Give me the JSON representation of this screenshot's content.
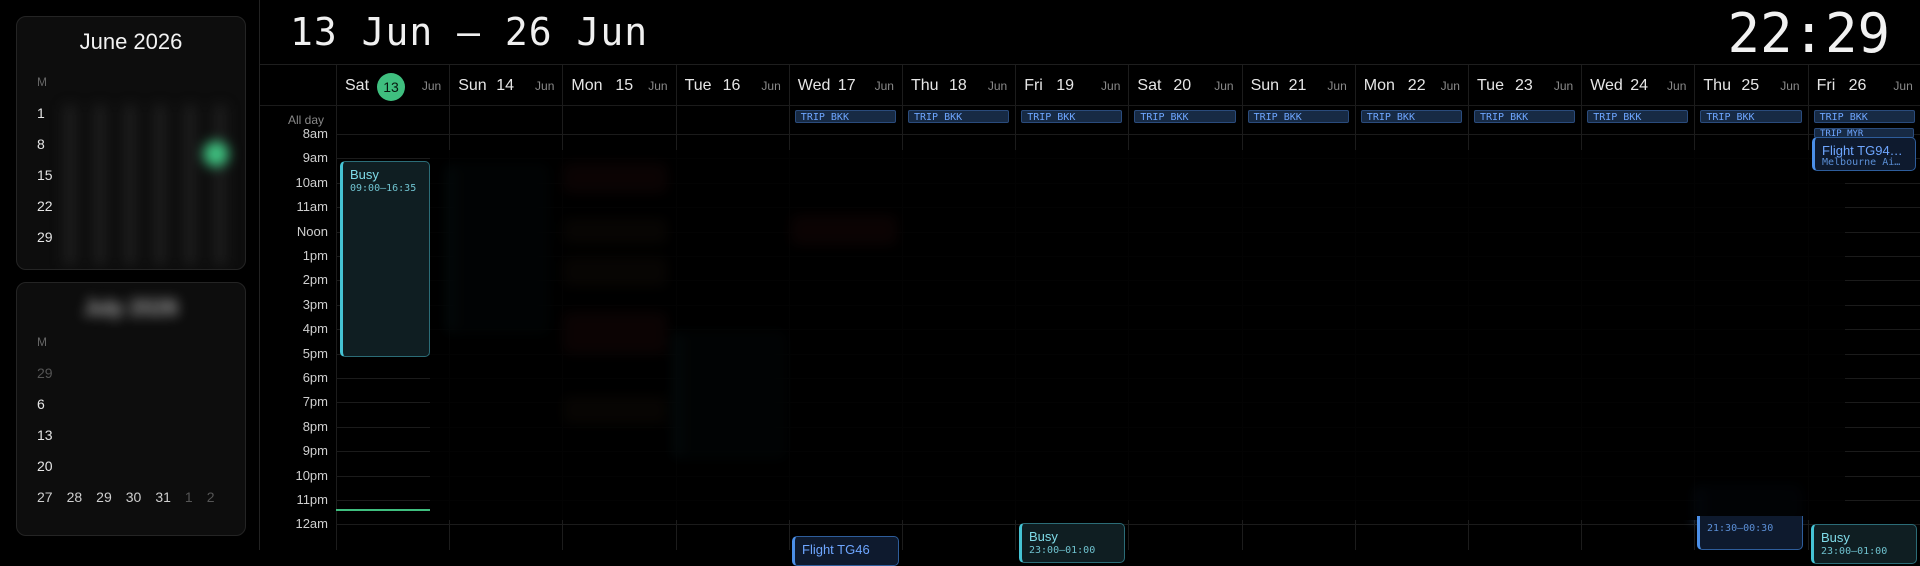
{
  "header": {
    "range": "13 Jun – 26 Jun",
    "clock": "22:29"
  },
  "sidebar": {
    "june": {
      "title": "June 2026",
      "weekday_initial": "M",
      "rows": [
        "1",
        "8",
        "15",
        "22",
        "29"
      ],
      "today": "13"
    },
    "july": {
      "title": "July 2026",
      "weekday_initial": "M",
      "rows": [
        "29",
        "6",
        "13",
        "20",
        "27"
      ],
      "last_row": [
        "27",
        "28",
        "29",
        "30",
        "31",
        "1",
        "2"
      ]
    }
  },
  "grid": {
    "allday_label": "All day",
    "time_labels": [
      "8am",
      "9am",
      "10am",
      "11am",
      "Noon",
      "1pm",
      "2pm",
      "3pm",
      "4pm",
      "5pm",
      "6pm",
      "7pm",
      "8pm",
      "9pm",
      "10pm",
      "11pm",
      "12am"
    ],
    "days": [
      {
        "name": "Sat",
        "date": "13",
        "month": "Jun",
        "today": true
      },
      {
        "name": "Sun",
        "date": "14",
        "month": "Jun"
      },
      {
        "name": "Mon",
        "date": "15",
        "month": "Jun"
      },
      {
        "name": "Tue",
        "date": "16",
        "month": "Jun"
      },
      {
        "name": "Wed",
        "date": "17",
        "month": "Jun"
      },
      {
        "name": "Thu",
        "date": "18",
        "month": "Jun"
      },
      {
        "name": "Fri",
        "date": "19",
        "month": "Jun"
      },
      {
        "name": "Sat",
        "date": "20",
        "month": "Jun"
      },
      {
        "name": "Sun",
        "date": "21",
        "month": "Jun"
      },
      {
        "name": "Mon",
        "date": "22",
        "month": "Jun"
      },
      {
        "name": "Tue",
        "date": "23",
        "month": "Jun"
      },
      {
        "name": "Wed",
        "date": "24",
        "month": "Jun"
      },
      {
        "name": "Thu",
        "date": "25",
        "month": "Jun"
      },
      {
        "name": "Fri",
        "date": "26",
        "month": "Jun"
      }
    ],
    "trip_label": "TRIP BKK",
    "trip_myr_label": "TRIP MYR"
  },
  "events": {
    "sat_busy": {
      "title": "Busy",
      "time": "09:00–16:35"
    },
    "fri26_flight": {
      "title": "Flight TG94…",
      "sub": "Melbourne Ai…"
    },
    "wed_flight": {
      "title": "Flight TG46"
    },
    "fri19_busy": {
      "title": "Busy",
      "time": "23:00–01:00"
    },
    "thu25_event": {
      "time": "21:30–00:30"
    },
    "fri26_busy": {
      "title": "Busy",
      "time": "23:00–01:00"
    }
  },
  "colors": {
    "accent": "#3fbf7f",
    "busy": "#45c3d4",
    "flight": "#4b8fe8",
    "trip": "#6ea6ff"
  }
}
